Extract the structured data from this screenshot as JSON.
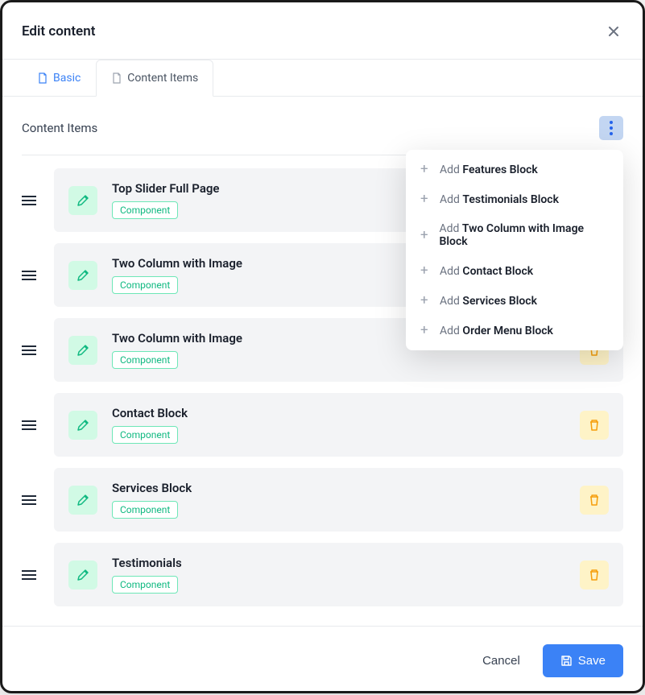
{
  "header": {
    "title": "Edit content"
  },
  "tabs": [
    {
      "label": "Basic",
      "active": false
    },
    {
      "label": "Content Items",
      "active": true
    }
  ],
  "section": {
    "title": "Content Items"
  },
  "items": [
    {
      "title": "Top Slider Full Page",
      "badge": "Component",
      "showDelete": false
    },
    {
      "title": "Two Column with Image",
      "badge": "Component",
      "showDelete": false
    },
    {
      "title": "Two Column with Image",
      "badge": "Component",
      "showDelete": true
    },
    {
      "title": "Contact Block",
      "badge": "Component",
      "showDelete": true
    },
    {
      "title": "Services Block",
      "badge": "Component",
      "showDelete": true
    },
    {
      "title": "Testimonials",
      "badge": "Component",
      "showDelete": true
    }
  ],
  "dropdown": {
    "prefix": "Add",
    "options": [
      {
        "label": "Features Block"
      },
      {
        "label": "Testimonials Block"
      },
      {
        "label": "Two Column with Image Block"
      },
      {
        "label": "Contact Block"
      },
      {
        "label": "Services Block"
      },
      {
        "label": "Order Menu Block"
      }
    ]
  },
  "footer": {
    "cancel": "Cancel",
    "save": "Save"
  },
  "icons": {
    "document": "doc",
    "pencil": "edit",
    "trash": "delete",
    "save": "floppy"
  },
  "colors": {
    "primary": "#3b82f6",
    "success": "#10b981",
    "warning": "#f59e0b"
  }
}
